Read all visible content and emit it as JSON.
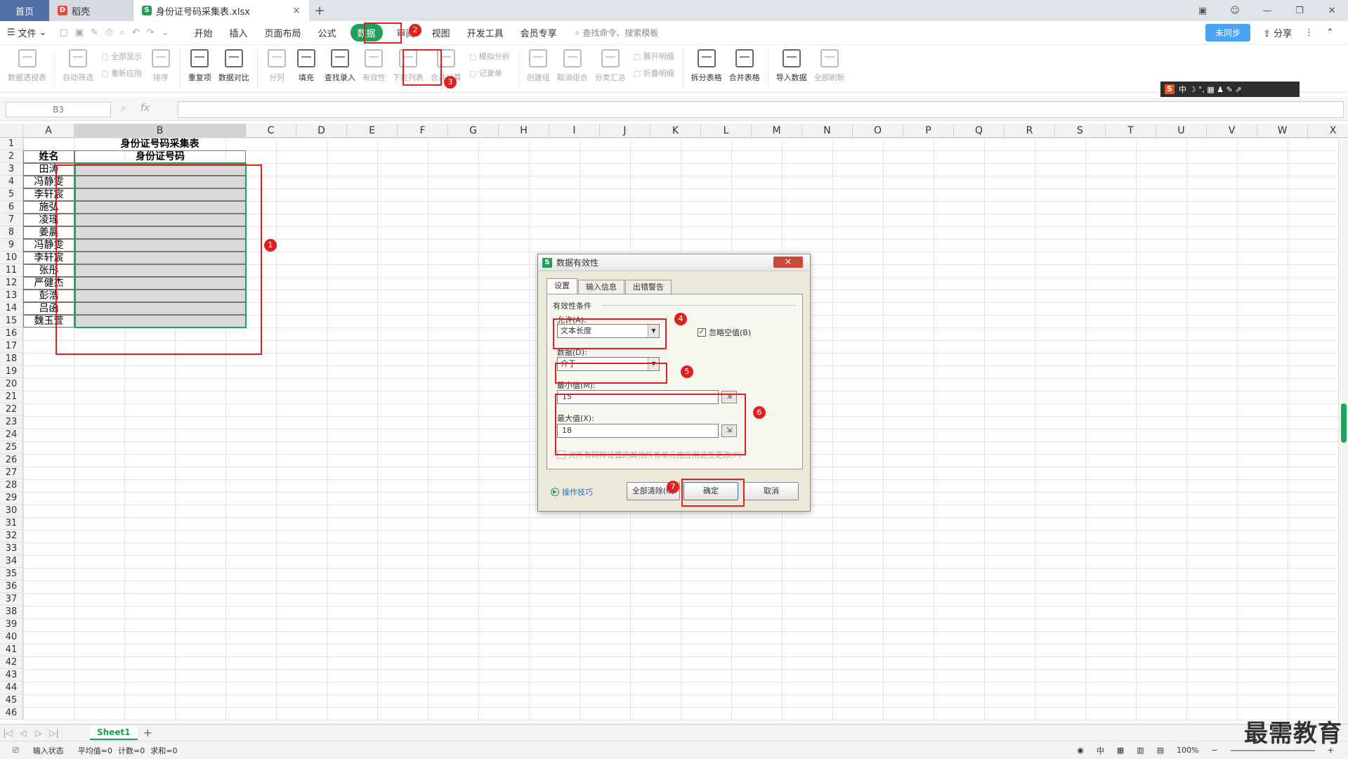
{
  "tabs": {
    "home": "首页",
    "doc": "稻壳",
    "active_file": "身份证号码采集表.xlsx",
    "close": "×",
    "new": "+"
  },
  "menu": {
    "file": "文件",
    "items": [
      "开始",
      "插入",
      "页面布局",
      "公式",
      "数据",
      "审阅",
      "视图",
      "开发工具",
      "会员专享"
    ],
    "search": "查找命令、搜索模板",
    "share": "分享",
    "badge": "未同步"
  },
  "ribbon": {
    "pivot": "数据透视表",
    "autofilter": "自动筛选",
    "show_all": "全部显示",
    "reapply": "重新应用",
    "sort": "排序",
    "duplicates": "重复项",
    "compare": "数据对比",
    "split": "分列",
    "fill": "填充",
    "lookup": "查找录入",
    "validity": "有效性",
    "dropdown": "下拉列表",
    "consolidate": "合并计算",
    "whatif": "模拟分析",
    "record": "记录单",
    "group": "创建组",
    "ungroup": "取消组合",
    "subtotal": "分类汇总",
    "expand": "展开明细",
    "collapse": "折叠明细",
    "split_table": "拆分表格",
    "merge_table": "合并表格",
    "import": "导入数据",
    "refresh_all": "全部刷新"
  },
  "ime": {
    "s": "S",
    "text": "中 ☽ °, ▦ ♟ ✎ ⇗"
  },
  "formula": {
    "cellref": "B3",
    "fx": "fx",
    "value": ""
  },
  "columns": [
    "A",
    "B",
    "C",
    "D",
    "E",
    "F",
    "G",
    "H",
    "I",
    "J",
    "K",
    "L",
    "M",
    "N",
    "O",
    "P",
    "Q",
    "R",
    "S",
    "T",
    "U",
    "V",
    "W",
    "X"
  ],
  "rows": [
    "1",
    "2",
    "3",
    "4",
    "5",
    "6",
    "7",
    "8",
    "9",
    "10",
    "11",
    "12",
    "13",
    "14",
    "15",
    "16",
    "17",
    "18",
    "19",
    "20",
    "21",
    "22",
    "23",
    "24",
    "25",
    "26",
    "27",
    "28",
    "29",
    "30",
    "31",
    "32",
    "33",
    "34",
    "35",
    "36",
    "37",
    "38",
    "39",
    "40",
    "41",
    "42",
    "43",
    "44",
    "45",
    "46"
  ],
  "sheet": {
    "title": "身份证号码采集表",
    "header_name": "姓名",
    "header_id": "身份证号码",
    "names": [
      "田涛",
      "冯静雯",
      "李轩宸",
      "施弘",
      "凌瑶",
      "姜晨",
      "冯静雯",
      "李轩宸",
      "张彤",
      "严健杰",
      "彭浩",
      "吕函",
      "魏玉萱"
    ]
  },
  "dialog": {
    "title": "数据有效性",
    "close": "×",
    "tabs": [
      "设置",
      "输入信息",
      "出错警告"
    ],
    "section": "有效性条件",
    "allow_label": "允许(A):",
    "allow_value": "文本长度",
    "ignore_blank": "忽略空值(B)",
    "data_label": "数据(D):",
    "data_value": "介于",
    "min_label": "最小值(M):",
    "min_value": "15",
    "max_label": "最大值(X):",
    "max_value": "18",
    "apply_all": "对所有同样设置的其他所有单元格应用这些更改(P)",
    "tips": "操作技巧",
    "clear_all": "全部清除(C)",
    "ok": "确定",
    "cancel": "取消"
  },
  "annotations": [
    "1",
    "2",
    "3",
    "4",
    "5",
    "6",
    "7"
  ],
  "sheetbar": {
    "nav": [
      "|◁",
      "◁",
      "▷",
      "▷|"
    ],
    "sheet1": "Sheet1",
    "add": "+"
  },
  "status": {
    "mode": "输入状态",
    "avg": "平均值=0",
    "count": "计数=0",
    "sum": "求和=0",
    "zoom": "100%",
    "lang": "中"
  },
  "watermark": "最需教育",
  "colors": {
    "accent": "#1fa55b",
    "annotation": "#e02020",
    "selected_fill": "#d9d9d9"
  }
}
